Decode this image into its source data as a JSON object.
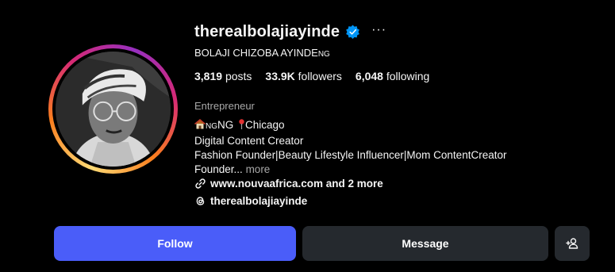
{
  "profile": {
    "username": "therealbolajiayinde",
    "full_name": "BOLAJI CHIZOBA AYINDE",
    "full_name_suffix": "NG",
    "verified": true,
    "stats": {
      "posts_count": "3,819",
      "posts_label": "posts",
      "followers_count": "33.9K",
      "followers_label": "followers",
      "following_count": "6,048",
      "following_label": "following"
    },
    "category": "Entrepreneur",
    "bio": {
      "line1_flag": "NG",
      "line1_text": "NG",
      "line1_city": "Chicago",
      "line2": "Digital Content Creator",
      "line3": "Fashion Founder|Beauty Lifestyle Influencer|Mom ContentCreator",
      "line4": "Founder...",
      "more_label": "more"
    },
    "website": "www.nouvaafrica.com and 2 more",
    "threads_handle": "therealbolajiayinde"
  },
  "actions": {
    "follow_label": "Follow",
    "message_label": "Message"
  },
  "colors": {
    "follow_button": "#4a5df9",
    "secondary_button": "#25292e",
    "verified_badge": "#0095f6",
    "muted_text": "#a8a8a8"
  },
  "icons": [
    "verified-badge-icon",
    "more-options-icon",
    "house-icon",
    "pin-icon",
    "link-icon",
    "threads-icon",
    "add-person-icon"
  ]
}
